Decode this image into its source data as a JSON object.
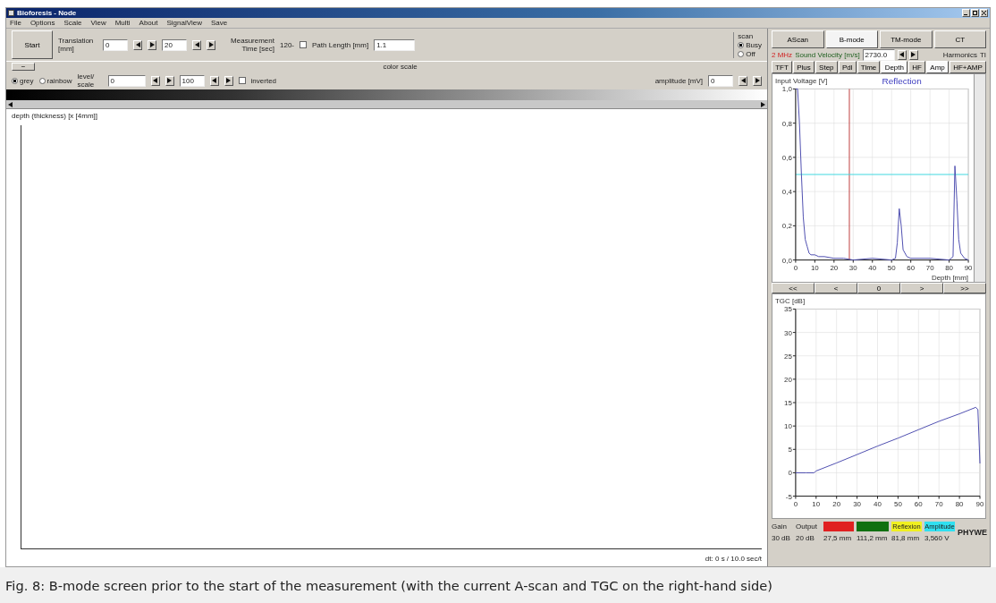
{
  "window": {
    "title": "Bioforesis - Node"
  },
  "menu": [
    "File",
    "Options",
    "Scale",
    "View",
    "Multi",
    "About",
    "SignalView",
    "Save"
  ],
  "toolbar": {
    "start_button": "Start",
    "translation_label": "Translation [mm]",
    "translation_from": "0",
    "translation_to": "20",
    "measurement_time_label": "Measurement Time [sec]",
    "prefix": "120-",
    "path_length": {
      "label": "Path Length [mm]",
      "checked": false,
      "value": "1.1"
    },
    "scan_group": {
      "label": "scan",
      "options": [
        {
          "label": "Busy",
          "selected": true
        },
        {
          "label": "Off",
          "selected": false
        }
      ]
    }
  },
  "color_scale": {
    "collapse_button": "−",
    "title": "color scale",
    "modes": [
      {
        "label": "grey",
        "selected": true
      },
      {
        "label": "rainbow",
        "selected": false
      }
    ],
    "level_label": "level/ scale",
    "level_from": "0",
    "level_to": "100",
    "inverted": {
      "label": "inverted",
      "checked": false
    },
    "amplitude_label": "amplitude [mV]",
    "amplitude_value": "0"
  },
  "plot": {
    "axis_label": "depth (thickness) [x [4mm]]",
    "footer": "dt: 0 s / 10.0 sec/t"
  },
  "right_panel": {
    "tabs": [
      {
        "label": "AScan",
        "selected": false
      },
      {
        "label": "B-mode",
        "selected": true
      },
      {
        "label": "TM-mode",
        "selected": false
      },
      {
        "label": "CT",
        "selected": false
      }
    ],
    "frequency": "2 MHz",
    "sound_velocity_label": "Sound Velocity [m/s]",
    "sound_velocity": "2730.0",
    "harmonics_label": "Harmonics",
    "harmonics_value": "TI",
    "mode_tabs": [
      {
        "label": "TFT",
        "selected": false
      },
      {
        "label": "Plus",
        "selected": false
      },
      {
        "label": "Step",
        "selected": false
      },
      {
        "label": "Pdl",
        "selected": false
      },
      {
        "label": "Time",
        "selected": false
      },
      {
        "label": "Depth",
        "selected": true
      },
      {
        "label": "HF",
        "selected": false
      },
      {
        "label": "Amp",
        "selected": true
      },
      {
        "label": "HF+AMP",
        "selected": false
      }
    ],
    "ascan": {
      "chart_data": {
        "type": "line",
        "title": "Reflection",
        "xlabel": "Depth [mm]",
        "ylabel": "Input Voltage [V]",
        "xlim": [
          0,
          90
        ],
        "ylim": [
          0,
          1
        ],
        "grid": true,
        "xticks": [
          0,
          10,
          20,
          30,
          40,
          50,
          60,
          70,
          80,
          90
        ],
        "yticks": [
          {
            "value": 0,
            "label": "0,0"
          },
          {
            "value": 0.2,
            "label": "0,2"
          },
          {
            "value": 0.4,
            "label": "0,4"
          },
          {
            "value": 0.6,
            "label": "0,6"
          },
          {
            "value": 0.8,
            "label": "0,8"
          },
          {
            "value": 1,
            "label": "1,0"
          }
        ],
        "x": [
          0,
          1,
          2,
          3,
          4,
          5,
          6,
          7,
          8,
          10,
          12,
          15,
          20,
          25,
          30,
          40,
          50,
          52,
          53,
          54,
          55,
          56,
          58,
          60,
          70,
          80,
          82,
          83,
          84,
          85,
          86,
          88,
          90
        ],
        "series": [
          {
            "color": "#5050b0",
            "values": [
              1.0,
              1.0,
              0.8,
              0.5,
              0.25,
              0.12,
              0.08,
              0.04,
              0.03,
              0.03,
              0.02,
              0.02,
              0.01,
              0.01,
              0.0,
              0.01,
              0.0,
              0.01,
              0.1,
              0.3,
              0.2,
              0.06,
              0.02,
              0.01,
              0.01,
              0.0,
              0.02,
              0.55,
              0.35,
              0.12,
              0.04,
              0.01,
              0.0
            ]
          }
        ],
        "ref_lines": [
          {
            "axis": "x",
            "value": 28,
            "color": "#c04040"
          },
          {
            "axis": "y",
            "value": 0.5,
            "color": "#40d8e0"
          }
        ]
      }
    },
    "nav_buttons": [
      "<<",
      "<",
      "0",
      ">",
      ">>"
    ],
    "tgc": {
      "chart_data": {
        "type": "line",
        "ylabel": "TGC [dB]",
        "xlim": [
          0,
          90
        ],
        "ylim": [
          -5,
          35
        ],
        "grid": true,
        "xticks": [
          0,
          10,
          20,
          30,
          40,
          50,
          60,
          70,
          80,
          90
        ],
        "yticks": [
          -5,
          0,
          5,
          10,
          15,
          20,
          25,
          30,
          35
        ],
        "x": [
          0,
          5,
          9,
          10,
          20,
          30,
          40,
          50,
          60,
          70,
          80,
          88,
          89,
          90
        ],
        "series": [
          {
            "color": "#5050b0",
            "values": [
              0,
              0,
              0,
              0.4,
              2.1,
              3.9,
              5.7,
              7.4,
              9.2,
              11,
              12.6,
              14,
              13.5,
              2
            ]
          }
        ]
      }
    },
    "status": [
      {
        "kind": "text",
        "label": "Gain",
        "value": "30 dB"
      },
      {
        "kind": "text",
        "label": "Output",
        "value": "20 dB"
      },
      {
        "kind": "swatch",
        "color": "#e02020",
        "value": "27,5 mm"
      },
      {
        "kind": "swatch",
        "color": "#107010",
        "value": "111,2 mm"
      },
      {
        "kind": "swatch",
        "color": "#f0f020",
        "label": "Reflexion",
        "value": "81,8 mm"
      },
      {
        "kind": "swatch",
        "color": "#30e0f0",
        "label": "Amplitude",
        "value": "3,560 V"
      }
    ],
    "logo": "PHYWE"
  },
  "caption": "Fig. 8: B-mode screen prior to the start of the measurement (with the current A-scan and TGC on the right-hand side)"
}
